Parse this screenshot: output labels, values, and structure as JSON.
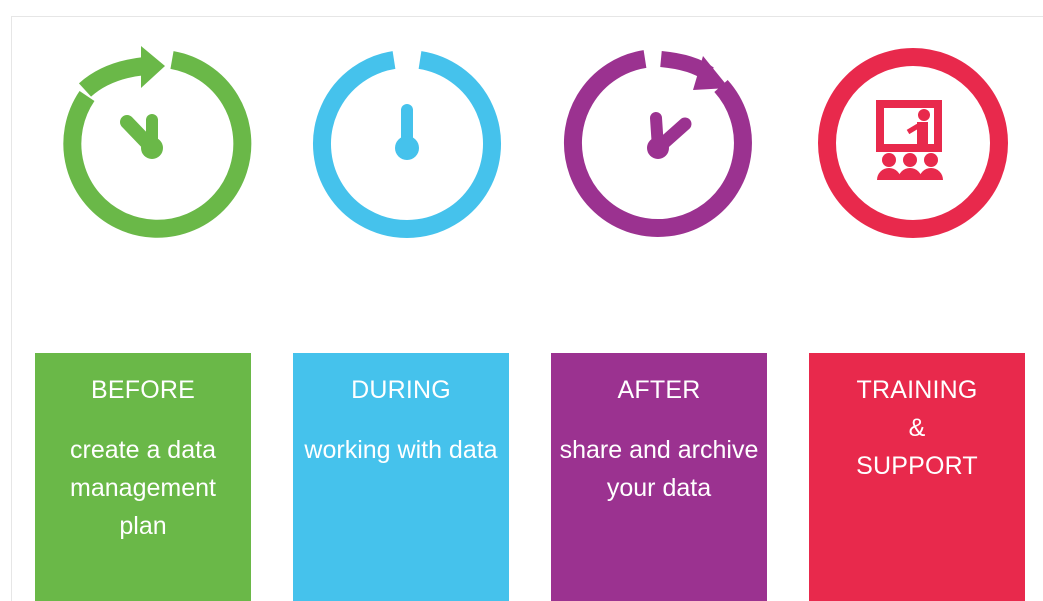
{
  "colors": {
    "before": "#6ab848",
    "during": "#45c2ec",
    "after": "#9b3290",
    "training": "#e8294c"
  },
  "icons": {
    "before": "clock-forward-arrow-icon",
    "during": "clock-twelve-icon",
    "after": "clock-forward-arrow-icon",
    "training": "presentation-training-icon"
  },
  "cards": {
    "before": {
      "title": "BEFORE",
      "desc": "create a data management plan"
    },
    "during": {
      "title": "DURING",
      "desc": "working with data"
    },
    "after": {
      "title": "AFTER",
      "desc": "share and archive your data"
    },
    "training": {
      "line1": "TRAINING",
      "line2": "&",
      "line3": "SUPPORT"
    }
  }
}
